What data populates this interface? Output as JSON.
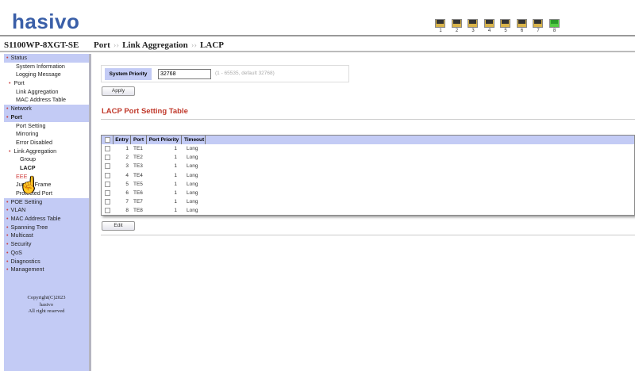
{
  "header": {
    "logo": "hasivo",
    "ports": [
      {
        "label": "1",
        "status": "down"
      },
      {
        "label": "2",
        "status": "down"
      },
      {
        "label": "3",
        "status": "down"
      },
      {
        "label": "4",
        "status": "down"
      },
      {
        "label": "5",
        "status": "down"
      },
      {
        "label": "6",
        "status": "down"
      },
      {
        "label": "7",
        "status": "down"
      },
      {
        "label": "8",
        "status": "up"
      }
    ]
  },
  "titlebar": {
    "model": "S1100WP-8XGT-SE",
    "breadcrumb": [
      "Port",
      "Link Aggregation",
      "LACP"
    ],
    "separator": "››"
  },
  "sidebar": {
    "items": [
      {
        "label": "Status",
        "type": "top"
      },
      {
        "label": "System Information",
        "type": "l1"
      },
      {
        "label": "Logging Message",
        "type": "l1"
      },
      {
        "label": "Port",
        "type": "l1b"
      },
      {
        "label": "Link Aggregation",
        "type": "l1"
      },
      {
        "label": "MAC Address Table",
        "type": "l1"
      },
      {
        "label": "Network",
        "type": "top"
      },
      {
        "label": "Port",
        "type": "top",
        "bold": true
      },
      {
        "label": "Port Setting",
        "type": "l1"
      },
      {
        "label": "Mirroring",
        "type": "l1"
      },
      {
        "label": "Error Disabled",
        "type": "l1"
      },
      {
        "label": "Link Aggregation",
        "type": "l1b"
      },
      {
        "label": "Group",
        "type": "l2"
      },
      {
        "label": "LACP",
        "type": "l2",
        "bold": true
      },
      {
        "label": "EEE",
        "type": "l1",
        "hover": true
      },
      {
        "label": "Jumbo Frame",
        "type": "l1"
      },
      {
        "label": "Protected Port",
        "type": "l1"
      },
      {
        "label": "POE Setting",
        "type": "top"
      },
      {
        "label": "VLAN",
        "type": "top"
      },
      {
        "label": "MAC Address Table",
        "type": "top"
      },
      {
        "label": "Spanning Tree",
        "type": "top"
      },
      {
        "label": "Multicast",
        "type": "top"
      },
      {
        "label": "Security",
        "type": "top"
      },
      {
        "label": "QoS",
        "type": "top"
      },
      {
        "label": "Diagnostics",
        "type": "top"
      },
      {
        "label": "Management",
        "type": "top"
      }
    ],
    "copyright": [
      "Copyright(C)2023",
      "hasivo",
      "All right reserved"
    ]
  },
  "main": {
    "system_priority": {
      "label": "System Priority",
      "value": "32768",
      "hint": "(1 - 65535, default 32768)"
    },
    "apply_label": "Apply",
    "section_title": "LACP Port Setting Table",
    "table": {
      "headers": [
        "Entry",
        "Port",
        "Port Priority",
        "Timeout"
      ],
      "rows": [
        [
          "1",
          "TE1",
          "1",
          "Long"
        ],
        [
          "2",
          "TE2",
          "1",
          "Long"
        ],
        [
          "3",
          "TE3",
          "1",
          "Long"
        ],
        [
          "4",
          "TE4",
          "1",
          "Long"
        ],
        [
          "5",
          "TE5",
          "1",
          "Long"
        ],
        [
          "6",
          "TE6",
          "1",
          "Long"
        ],
        [
          "7",
          "TE7",
          "1",
          "Long"
        ],
        [
          "8",
          "TE8",
          "1",
          "Long"
        ]
      ]
    },
    "edit_label": "Edit"
  },
  "colors": {
    "accent": "#c3cbf5",
    "title": "#c0392b",
    "logo": "#3a5fa8",
    "link_hover": "#d04040"
  }
}
